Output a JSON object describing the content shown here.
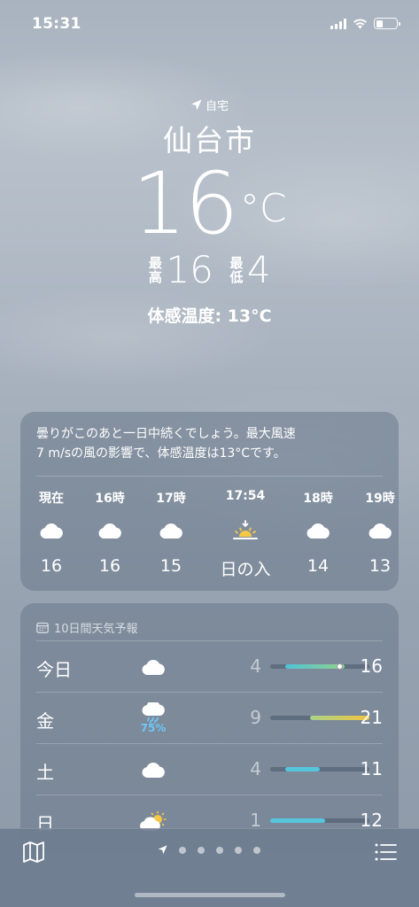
{
  "status_bar": {
    "time": "15:31",
    "battery_level": 0.35
  },
  "location": {
    "label": "自宅",
    "city": "仙台市"
  },
  "current": {
    "temp": "16",
    "unit": "°C",
    "high_label": "最高",
    "high": "16",
    "low_label": "最低",
    "low": "4",
    "feels_like": "体感温度: 13°C"
  },
  "hourly": {
    "summary_line1": "曇りがこのあと一日中続くでしょう。最大風速",
    "summary_line2": "7 m/sの風の影響で、体感温度は13°Cです。",
    "hours": [
      {
        "label": "現在",
        "icon": "cloud-icon",
        "temp": "16"
      },
      {
        "label": "16時",
        "icon": "cloud-icon",
        "temp": "16"
      },
      {
        "label": "17時",
        "icon": "cloud-icon",
        "temp": "15"
      },
      {
        "label": "17:54",
        "icon": "sunset-icon",
        "temp": "日の入"
      },
      {
        "label": "18時",
        "icon": "cloud-icon",
        "temp": "14"
      },
      {
        "label": "19時",
        "icon": "cloud-icon",
        "temp": "13"
      }
    ]
  },
  "daily": {
    "header": "10日間天気予報",
    "range_min": 1,
    "range_max": 21,
    "days": [
      {
        "name": "今日",
        "icon": "cloud-icon",
        "precip": "",
        "low": "4",
        "high": "16",
        "low_val": 4,
        "high_val": 16,
        "current_val": 15,
        "bar_color": "linear-gradient(90deg,#4fc3d9,#8fd18a)"
      },
      {
        "name": "金",
        "icon": "cloud-rain-icon",
        "precip": "75%",
        "low": "9",
        "high": "21",
        "low_val": 9,
        "high_val": 21,
        "bar_color": "linear-gradient(90deg,#a9d38a,#f2c43c)"
      },
      {
        "name": "土",
        "icon": "cloud-icon",
        "precip": "",
        "low": "4",
        "high": "11",
        "low_val": 4,
        "high_val": 11,
        "bar_color": "#56c6dc"
      },
      {
        "name": "日",
        "icon": "cloud-sun-icon",
        "precip": "",
        "low": "1",
        "high": "12",
        "low_val": 1,
        "high_val": 12,
        "bar_color": "#56c6dc"
      }
    ]
  }
}
